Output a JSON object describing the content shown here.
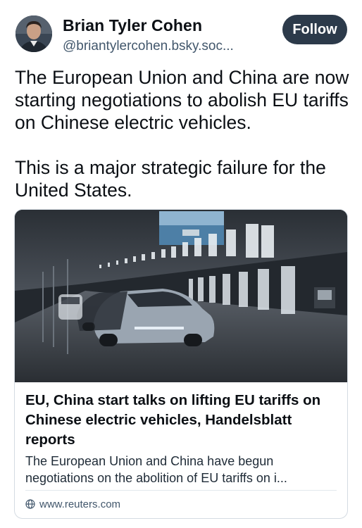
{
  "post": {
    "author_name": "Brian Tyler Cohen",
    "author_handle": "@briantylercohen.bsky.soc...",
    "follow_label": "Follow",
    "paragraphs": [
      "The European Union and China are now starting negotiations to abolish EU tariffs on Chinese electric vehicles.",
      "This is a major strategic failure for the United States."
    ]
  },
  "link_card": {
    "title": "EU, China start talks on lifting EU tariffs on Chinese electric vehicles, Handelsblatt reports",
    "description": "The European Union and China have begun negotiations on the abolition of EU tariffs on i...",
    "domain": "www.reuters.com"
  },
  "colors": {
    "follow_button": "#2c3a4a",
    "handle_text": "#42576c",
    "card_border": "#d4dbe2"
  },
  "icons": {
    "avatar": "profile-photo",
    "domain": "globe-icon"
  }
}
